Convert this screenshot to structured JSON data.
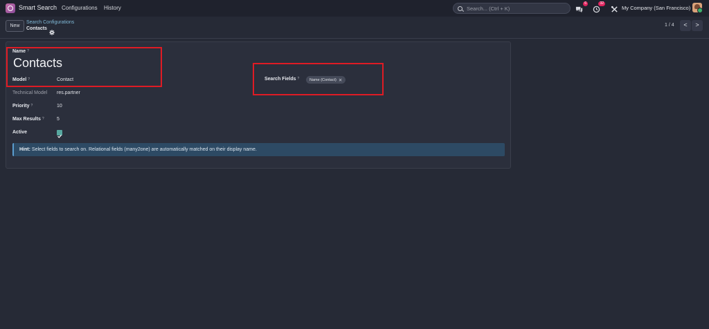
{
  "navbar": {
    "app_name": "Smart Search",
    "menus": [
      "Configurations",
      "History"
    ],
    "search_placeholder": "Search... (Ctrl + K)",
    "chat_badge": "6",
    "activity_badge": "32",
    "company": "My Company (San Francisco)"
  },
  "control_panel": {
    "new_label": "New",
    "breadcrumb_parent": "Search Configurations",
    "breadcrumb_current": "Contacts",
    "pager": "1 / 4",
    "prev": "<",
    "next": ">"
  },
  "form": {
    "name_label": "Name",
    "name_value": "Contacts",
    "model_label": "Model",
    "model_value": "Contact",
    "technical_model_label": "Technical Model",
    "technical_model_value": "res.partner",
    "priority_label": "Priority",
    "priority_value": "10",
    "max_results_label": "Max Results",
    "max_results_value": "5",
    "active_label": "Active",
    "active_value": true,
    "search_fields_label": "Search Fields",
    "search_fields_tags": [
      "Name (Contact)"
    ],
    "help_mark": "?",
    "hint_bold": "Hint:",
    "hint_text": "Select fields to search on. Relational fields (many2one) are automatically matched on their display name."
  },
  "colors": {
    "background": "#262a36",
    "navbar": "#1f222d",
    "highlight_box": "#e01b24",
    "hint_background": "#2d4a64",
    "checkbox": "#57a8a0"
  }
}
